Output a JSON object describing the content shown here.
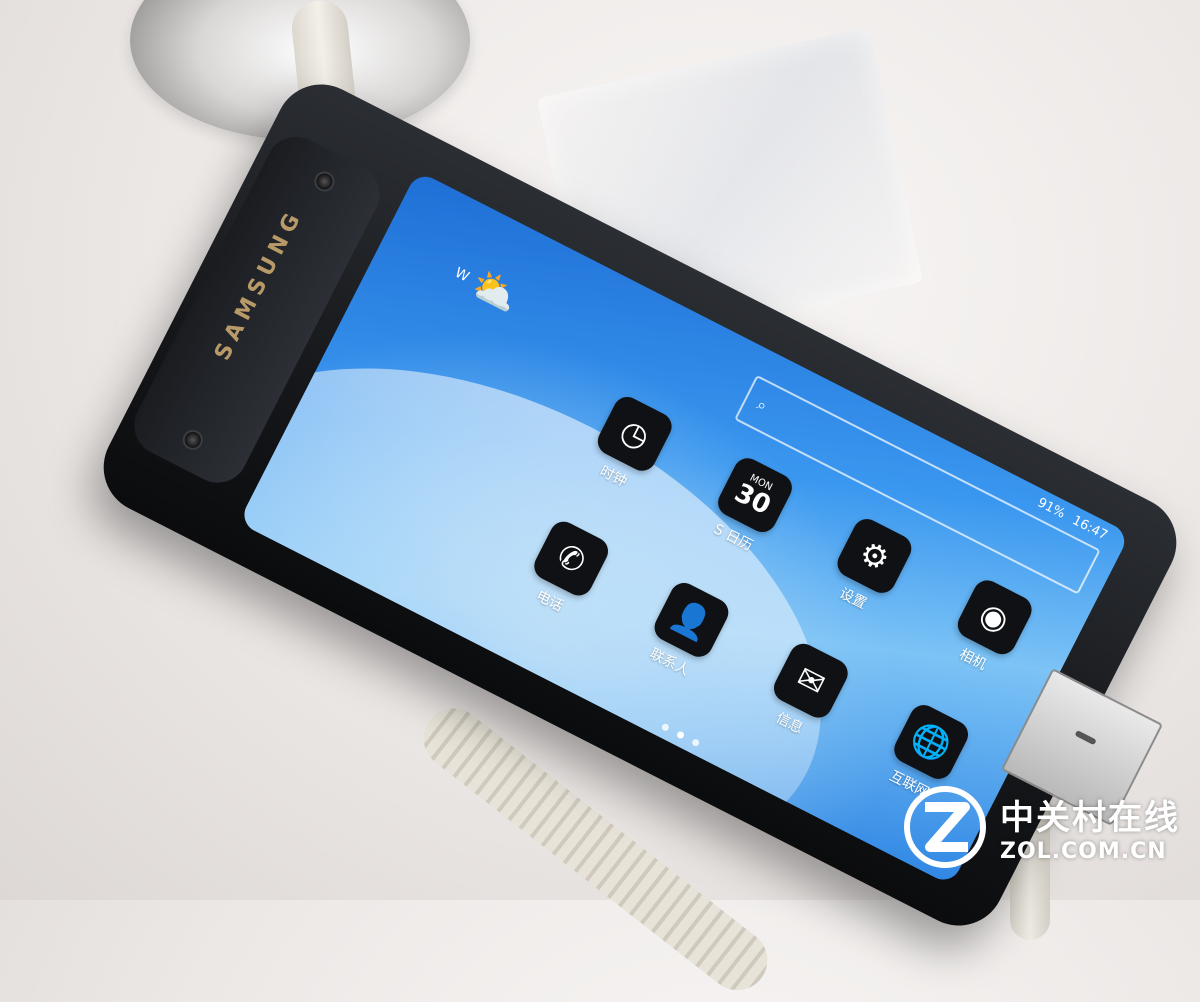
{
  "device": {
    "brand": "SAMSUNG",
    "status_bar": {
      "time": "16:47",
      "battery": "91%"
    },
    "weather_widget": {
      "carrier": "W",
      "icon": "weather-sun-cloud-icon"
    },
    "search_bar": {
      "icon": "search-icon"
    },
    "apps": [
      {
        "label": "相机",
        "icon": "camera-icon"
      },
      {
        "label": "设置",
        "icon": "gear-icon"
      },
      {
        "label": "互联网",
        "icon": "globe-icon"
      },
      {
        "label": "S 日历",
        "icon": "calendar-icon",
        "calendar_day": "30",
        "calendar_weekday": "MON"
      },
      {
        "label": "信息",
        "icon": "message-icon"
      },
      {
        "label": "时钟",
        "icon": "clock-icon"
      },
      {
        "label": "联系人",
        "icon": "contact-icon"
      },
      {
        "label": "电话",
        "icon": "phone-icon"
      }
    ]
  },
  "watermark": {
    "cn": "中关村在线",
    "en": "ZOL.COM.CN"
  }
}
